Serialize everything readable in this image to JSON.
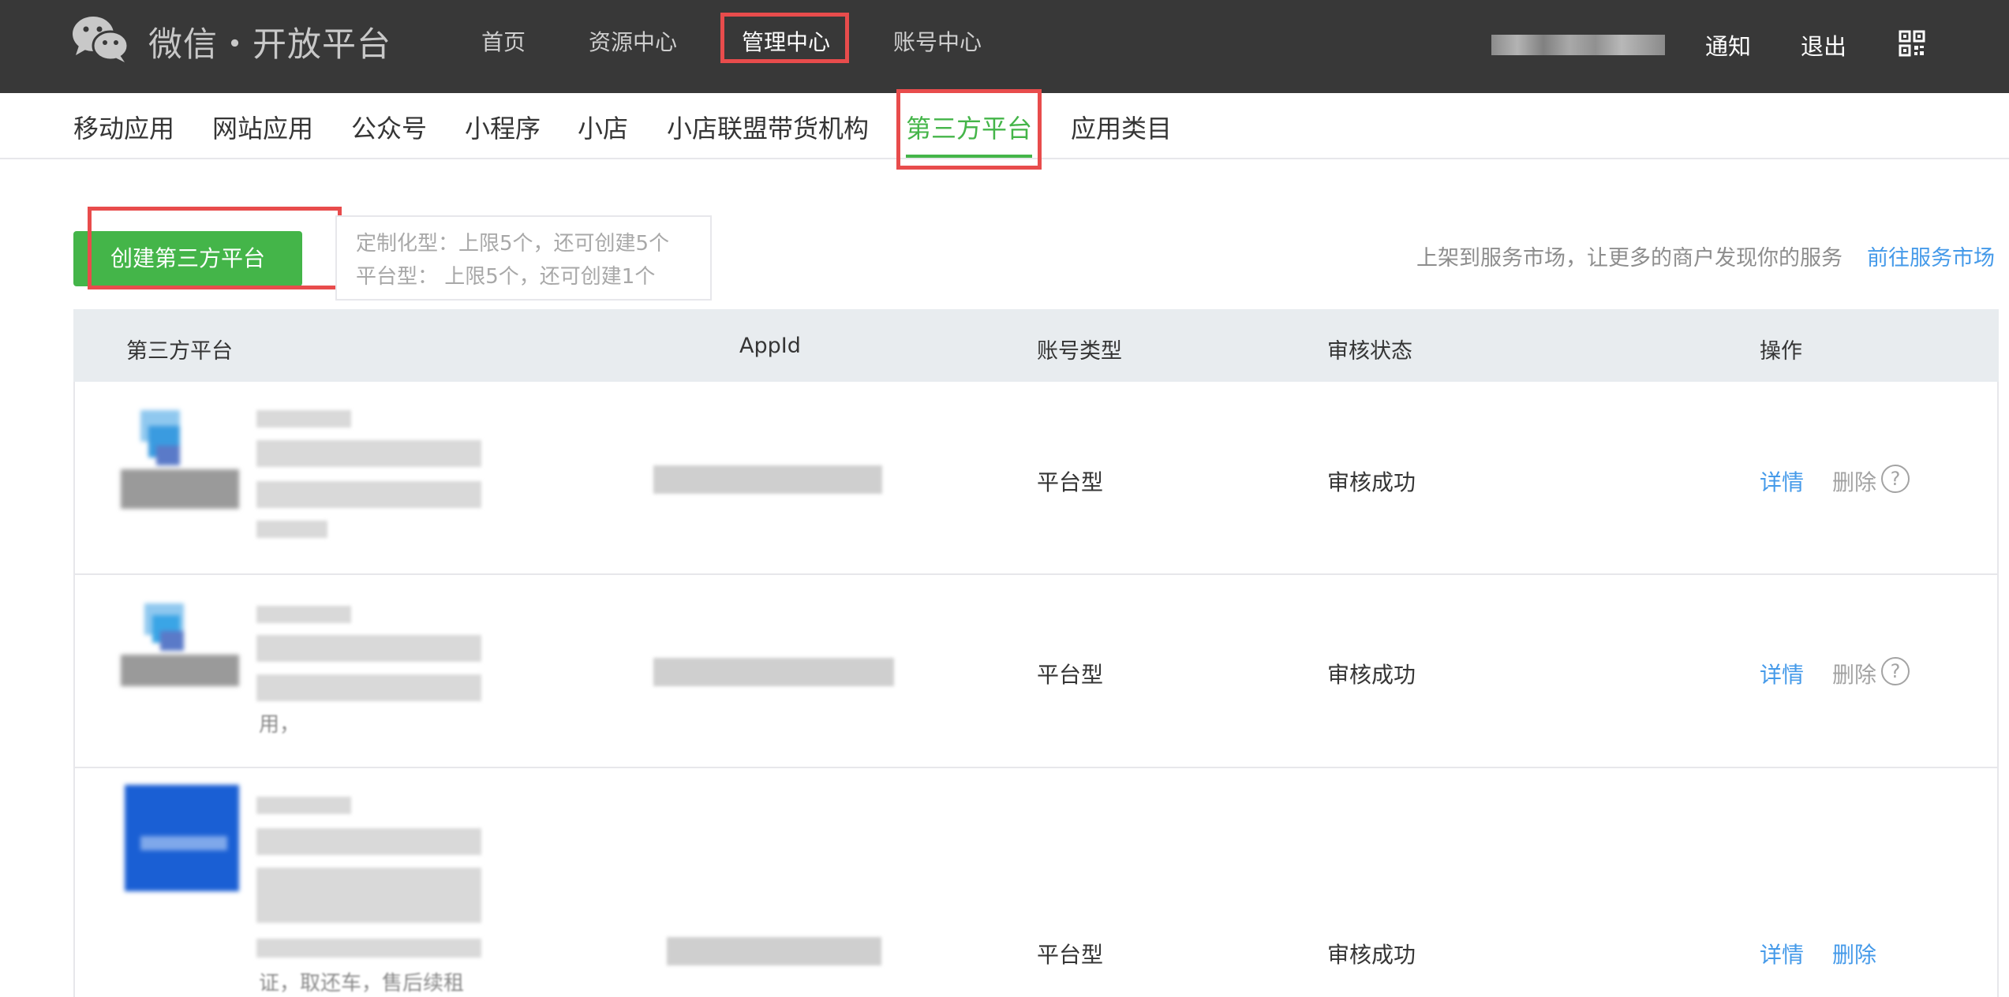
{
  "header": {
    "brand": "微信・开放平台",
    "nav": [
      "首页",
      "资源中心",
      "管理中心",
      "账号中心"
    ],
    "active_nav": "管理中心",
    "right": {
      "notify": "通知",
      "logout": "退出"
    }
  },
  "subnav": {
    "items": [
      "移动应用",
      "网站应用",
      "公众号",
      "小程序",
      "小店",
      "小店联盟带货机构",
      "第三方平台",
      "应用类目"
    ],
    "active": "第三方平台"
  },
  "toolbar": {
    "create_button": "创建第三方平台",
    "quota_custom": "定制化型：上限5个，还可创建5个",
    "quota_platform": "平台型：  上限5个，还可创建1个",
    "promo_text": "上架到服务市场，让更多的商户发现你的服务",
    "promo_link": "前往服务市场"
  },
  "table": {
    "columns": [
      "第三方平台",
      "AppId",
      "账号类型",
      "审核状态",
      "操作"
    ],
    "rows": [
      {
        "type": "平台型",
        "status": "审核成功",
        "detail": "详情",
        "delete": "删除",
        "delete_enabled": false,
        "help": "?",
        "desc_fragment": ""
      },
      {
        "type": "平台型",
        "status": "审核成功",
        "detail": "详情",
        "delete": "删除",
        "delete_enabled": false,
        "help": "?",
        "desc_fragment": "用，"
      },
      {
        "type": "平台型",
        "status": "审核成功",
        "detail": "详情",
        "delete": "删除",
        "delete_enabled": true,
        "help": "",
        "desc_fragment": "证，取还车，售后续租"
      }
    ]
  },
  "colors": {
    "topbar": "#383838",
    "accent_green": "#44b549",
    "link_blue": "#459ae9",
    "highlight_red": "#e84c4c"
  }
}
